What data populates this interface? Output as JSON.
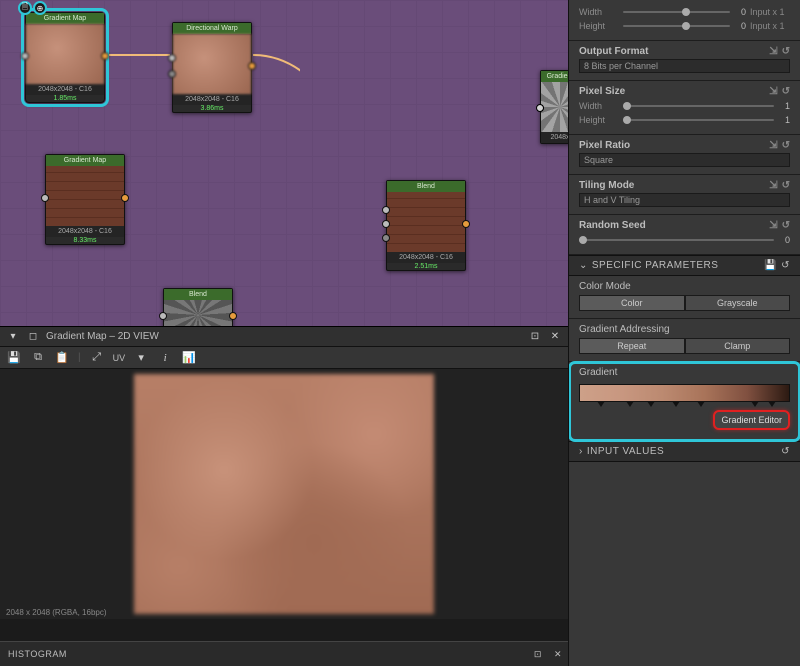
{
  "graph": {
    "nodes": [
      {
        "id": "n1",
        "title": "Gradient Map",
        "meta": "2048x2048 - C16",
        "timing": "1.85ms",
        "selected": true,
        "thumb": "tx-soft"
      },
      {
        "id": "n2",
        "title": "Directional Warp",
        "meta": "2048x2048 - C16",
        "timing": "3.86ms",
        "thumb": "tx-soft"
      },
      {
        "id": "n3",
        "title": "Gradient Map",
        "meta": "2048x2048 - C16",
        "timing": "8.33ms",
        "thumb": "tx-brick"
      },
      {
        "id": "n4",
        "title": "Blend",
        "meta": "2048x2048 - C16",
        "timing": "2.51ms",
        "thumb": "tx-brick"
      },
      {
        "id": "n5",
        "title": "Gradient",
        "meta": "2048x",
        "timing": "",
        "thumb": "tx-noise"
      },
      {
        "id": "n6",
        "title": "Blend",
        "meta": "",
        "timing": "",
        "thumb": "tx-grey"
      }
    ]
  },
  "preview": {
    "title": "Gradient Map – 2D VIEW",
    "toolbar": {
      "uv": "UV",
      "info": "i"
    },
    "footer": "2048 x 2048 (RGBA, 16bpc)"
  },
  "histogram": {
    "title": "HISTOGRAM"
  },
  "props": {
    "width": {
      "label": "Width",
      "value": "0",
      "suffix": "Input x 1",
      "pos": 55
    },
    "height": {
      "label": "Height",
      "value": "0",
      "suffix": "Input x 1",
      "pos": 55
    },
    "outputFormat": {
      "title": "Output Format",
      "select": "8 Bits per Channel"
    },
    "pixelSize": {
      "title": "Pixel Size",
      "width": {
        "label": "Width",
        "value": "1",
        "pos": 0
      },
      "height": {
        "label": "Height",
        "value": "1",
        "pos": 0
      }
    },
    "pixelRatio": {
      "title": "Pixel Ratio",
      "select": "Square"
    },
    "tiling": {
      "title": "Tiling Mode",
      "select": "H and V Tiling"
    },
    "seed": {
      "title": "Random Seed",
      "value": "0",
      "pos": 0
    },
    "specificBanner": "SPECIFIC PARAMETERS",
    "colorMode": {
      "title": "Color Mode",
      "opts": [
        "Color",
        "Grayscale"
      ],
      "active": 0
    },
    "addressing": {
      "title": "Gradient Addressing",
      "opts": [
        "Repeat",
        "Clamp"
      ],
      "active": 0
    },
    "gradient": {
      "title": "Gradient",
      "button": "Gradient Editor",
      "stops": [
        8,
        22,
        32,
        44,
        56,
        82,
        90
      ]
    },
    "inputBanner": "INPUT VALUES"
  },
  "icons": {
    "pin": "⇲",
    "reset": "↺",
    "expand": "▾",
    "collapse": "▸"
  }
}
